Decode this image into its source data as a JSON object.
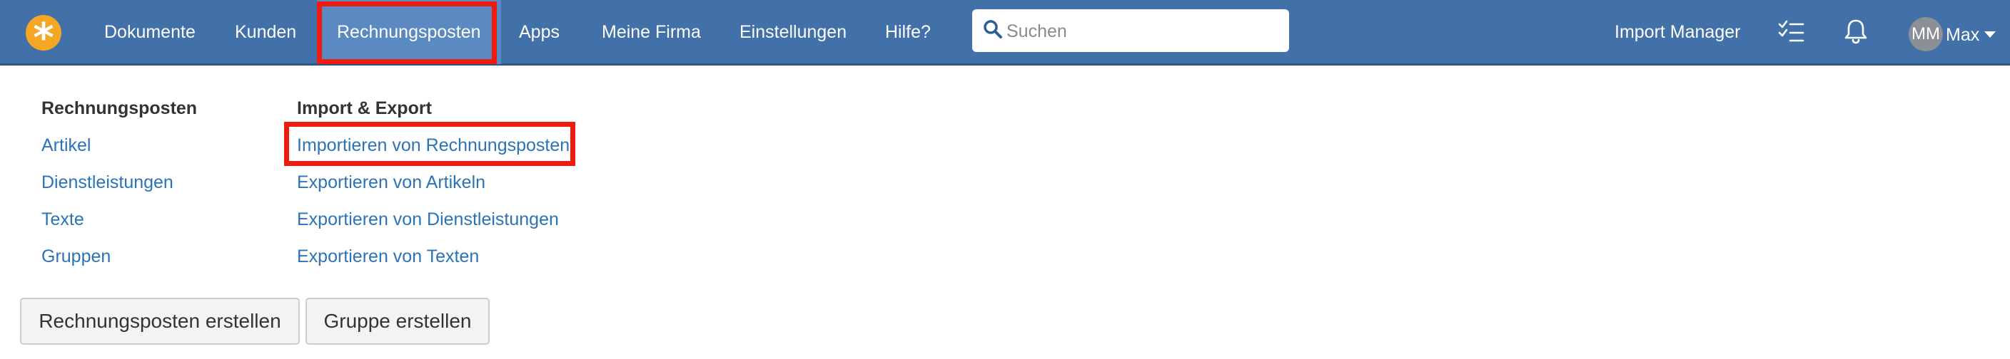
{
  "nav": {
    "logo_glyph": "*",
    "items": [
      {
        "label": "Dokumente"
      },
      {
        "label": "Kunden"
      },
      {
        "label": "Rechnungsposten",
        "active": true
      },
      {
        "label": "Apps"
      },
      {
        "label": "Meine Firma"
      },
      {
        "label": "Einstellungen"
      },
      {
        "label": "Hilfe?"
      }
    ],
    "search": {
      "placeholder": "Suchen",
      "value": ""
    },
    "import_manager_label": "Import Manager",
    "tasks_icon": "checklist-icon",
    "notifications_icon": "bell-icon",
    "user": {
      "initials": "MM",
      "name": "Max"
    }
  },
  "menu": {
    "col1": {
      "heading": "Rechnungsposten",
      "links": [
        "Artikel",
        "Dienstleistungen",
        "Texte",
        "Gruppen"
      ]
    },
    "col2": {
      "heading": "Import & Export",
      "links": [
        "Importieren von Rechnungsposten",
        "Exportieren von Artikeln",
        "Exportieren von Dienstleistungen",
        "Exportieren von Texten"
      ]
    }
  },
  "actions": {
    "create_item_label": "Rechnungsposten erstellen",
    "create_group_label": "Gruppe erstellen"
  },
  "colors": {
    "navbar": "#4270a8",
    "active_tab": "#5b89c2",
    "logo": "#f5a623",
    "link": "#2b73b6",
    "highlight": "#ee1c0e"
  }
}
